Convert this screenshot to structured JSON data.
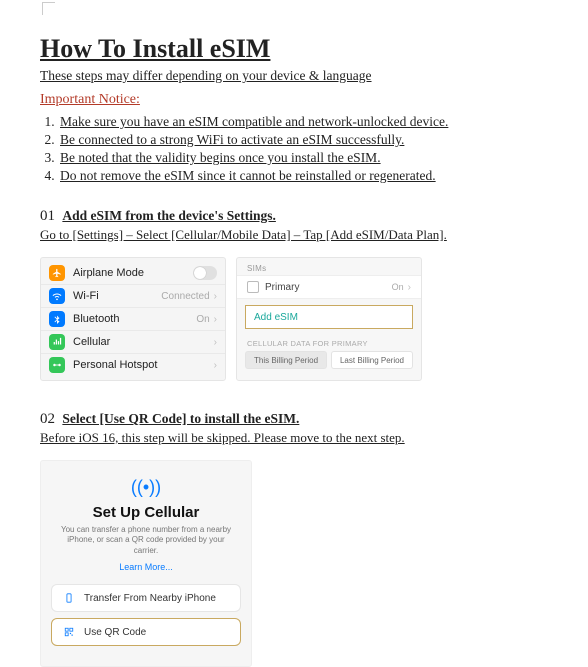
{
  "title": "How To Install eSIM",
  "intro": "These steps may differ depending on your device & language",
  "important_label": "Important Notice",
  "notice": [
    "Make sure you have an eSIM compatible and network-unlocked device.",
    "Be connected to a strong WiFi to activate an eSIM successfully.",
    "Be noted that the validity begins once you install the eSIM.",
    "Do not remove the eSIM since it cannot be reinstalled or regenerated."
  ],
  "step1": {
    "num": "01",
    "title": "Add eSIM from the device's Settings.",
    "path": "Go to [Settings] – Select [Cellular/Mobile Data] – Tap [Add eSIM/Data Plan]."
  },
  "settings_rows": {
    "airplane": "Airplane Mode",
    "wifi": "Wi-Fi",
    "wifi_val": "Connected",
    "bt": "Bluetooth",
    "bt_val": "On",
    "cell": "Cellular",
    "hotspot": "Personal Hotspot"
  },
  "sims": {
    "hdr": "SIMs",
    "primary": "Primary",
    "primary_state": "On",
    "add": "Add eSIM",
    "cell_hdr": "CELLULAR DATA FOR PRIMARY",
    "pill1": "This Billing Period",
    "pill2": "Last Billing Period"
  },
  "step2": {
    "num": "02",
    "title": "Select [Use QR Code] to install the eSIM.",
    "sub": "Before iOS 16, this step will be skipped. Please move to the next step."
  },
  "setup": {
    "title": "Set Up Cellular",
    "desc": "You can transfer a phone number from a nearby iPhone, or scan a QR code provided by your carrier.",
    "learn": "Learn More...",
    "btn_transfer": "Transfer From Nearby iPhone",
    "btn_qr": "Use QR Code"
  }
}
